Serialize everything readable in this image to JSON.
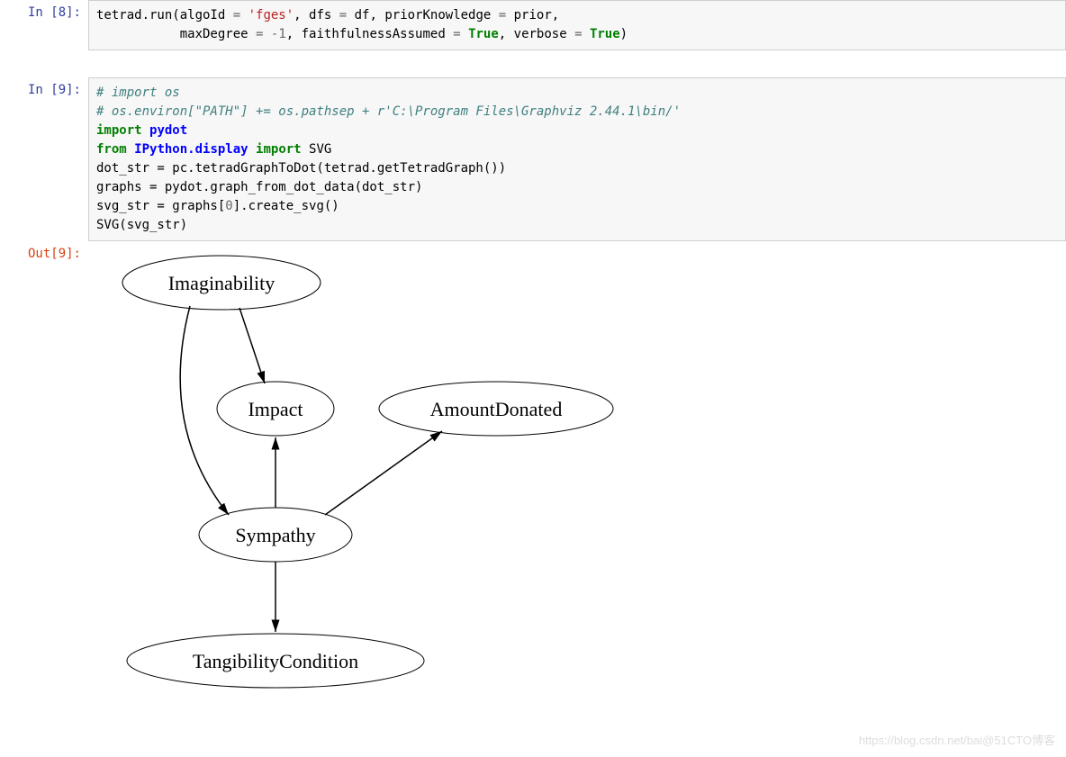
{
  "cells": {
    "in8": {
      "prompt": "In  [8]:",
      "line1_a": "tetrad.run(algoId ",
      "line1_eq": "=",
      "line1_sp": " ",
      "line1_str": "'fges'",
      "line1_b": ", dfs ",
      "line1_eq2": "=",
      "line1_c": " df, priorKnowledge ",
      "line1_eq3": "=",
      "line1_d": " prior,",
      "line2_pad": "           maxDegree ",
      "line2_eq": "=",
      "line2_sp": " ",
      "line2_num": "-1",
      "line2_b": ", faithfulnessAssumed ",
      "line2_eq2": "=",
      "line2_sp2": " ",
      "line2_bool": "True",
      "line2_c": ", verbose ",
      "line2_eq3": "=",
      "line2_sp3": " ",
      "line2_bool2": "True",
      "line2_end": ")"
    },
    "in9": {
      "prompt": "In  [9]:",
      "c1": "# import os",
      "c2": "# os.environ[\"PATH\"] += os.pathsep + r'C:\\Program Files\\Graphviz 2.44.1\\bin/'",
      "l3_import": "import",
      "l3_mod": "pydot",
      "l4_from": "from",
      "l4_mod": "IPython.display",
      "l4_import": "import",
      "l4_name": " SVG",
      "l5": "dot_str = pc.tetradGraphToDot(tetrad.getTetradGraph())",
      "l6": "graphs = pydot.graph_from_dot_data(dot_str)",
      "l7_a": "svg_str = graphs[",
      "l7_num": "0",
      "l7_b": "].create_svg()",
      "l8": "SVG(svg_str)"
    },
    "out9": {
      "prompt": "Out[9]:"
    }
  },
  "graph": {
    "nodes": {
      "imaginability": "Imaginability",
      "impact": "Impact",
      "amount": "AmountDonated",
      "sympathy": "Sympathy",
      "tangibility": "TangibilityCondition"
    }
  },
  "watermark": "https://blog.csdn.net/bai@51CTO博客"
}
